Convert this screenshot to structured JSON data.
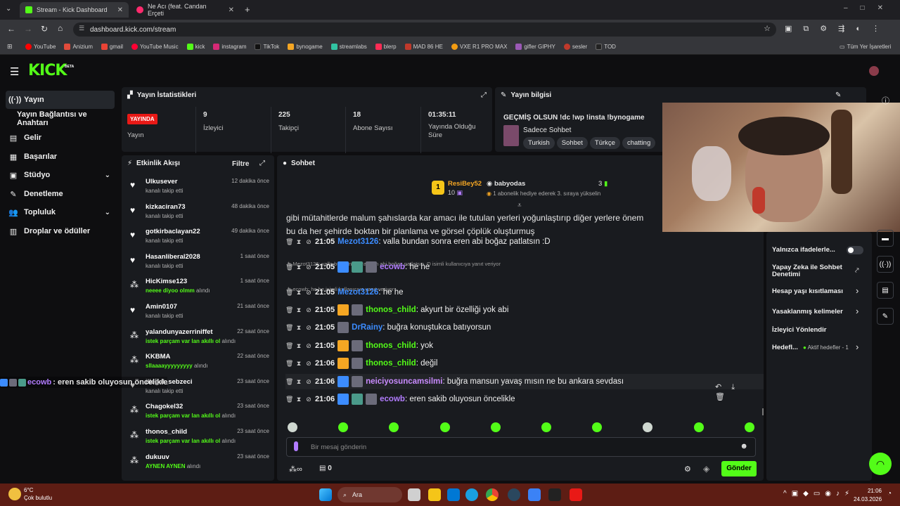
{
  "browser": {
    "tabs": [
      {
        "title": "Stream - Kick Dashboard",
        "active": true
      },
      {
        "title": "Ne Acı (feat. Candan Erçeti",
        "active": false
      }
    ],
    "url": "dashboard.kick.com/stream",
    "bookmarks": [
      "YouTube",
      "Anizium",
      "gmail",
      "YouTube Music",
      "kick",
      "instagram",
      "TikTok",
      "bynogame",
      "streamlabs",
      "blerp",
      "MAD 86 HE",
      "VXE R1 PRO MAX",
      "gifler GIPHY",
      "sesler",
      "TOD"
    ],
    "all_bookmarks": "Tüm Yer İşaretleri"
  },
  "kick": {
    "logo": "KICK",
    "logo_tag": "BETA"
  },
  "sidebar": {
    "items": [
      {
        "label": "Yayın",
        "icon": "broadcast-icon",
        "active": true
      },
      {
        "label": "Yayın Bağlantısı ve Anahtarı",
        "icon": "",
        "active": false
      },
      {
        "label": "Gelir",
        "icon": "dollar-icon",
        "active": false
      },
      {
        "label": "Başarılar",
        "icon": "trophy-icon",
        "active": false
      },
      {
        "label": "Stüdyo",
        "icon": "studio-icon",
        "active": false,
        "expandable": true
      },
      {
        "label": "Denetleme",
        "icon": "wrench-icon",
        "active": false
      },
      {
        "label": "Topluluk",
        "icon": "users-icon",
        "active": false,
        "expandable": true
      },
      {
        "label": "Droplar ve ödüller",
        "icon": "gift-icon",
        "active": false
      }
    ]
  },
  "stats": {
    "title": "Yayın İstatistikleri",
    "live_badge": "YAYINDA",
    "live_label": "Yayın",
    "items": [
      {
        "value": "9",
        "label": "İzleyici"
      },
      {
        "value": "225",
        "label": "Takipçi"
      },
      {
        "value": "18",
        "label": "Abone Sayısı"
      },
      {
        "value": "01:35:11",
        "label": "Yayında Olduğu Süre"
      }
    ]
  },
  "stream_info": {
    "title": "Yayın bilgisi",
    "stream_title": "GEÇMİŞ OLSUN !dc !wp !insta !bynogame",
    "category": "Sadece Sohbet",
    "tags": [
      "Turkish",
      "Sohbet",
      "Türkçe",
      "chatting"
    ]
  },
  "activity": {
    "title": "Etkinlik Akışı",
    "filter": "Filtre",
    "items": [
      {
        "name": "Ulkusever",
        "sub": "kanalı takip etti",
        "highlight": "",
        "time": "12 dakika önce",
        "icon": "heart-icon"
      },
      {
        "name": "kizkaciran73",
        "sub": "kanalı takip etti",
        "highlight": "",
        "time": "48 dakika önce",
        "icon": "heart-icon"
      },
      {
        "name": "gotkirbaclayan22",
        "sub": "kanalı takip etti",
        "highlight": "",
        "time": "49 dakika önce",
        "icon": "heart-icon"
      },
      {
        "name": "Hasanliberal2028",
        "sub": "kanalı takip etti",
        "highlight": "",
        "time": "1 saat önce",
        "icon": "heart-icon"
      },
      {
        "name": "HicKimse123",
        "sub": "alındı",
        "highlight": "neeee diyoo olmm",
        "time": "1 saat önce",
        "icon": "kicks-icon"
      },
      {
        "name": "Amin0107",
        "sub": "kanalı takip etti",
        "highlight": "",
        "time": "21 saat önce",
        "icon": "heart-icon"
      },
      {
        "name": "yalandunyazerriniffet",
        "sub": "alındı",
        "highlight": "istek parçam var lan akıllı ol",
        "time": "22 saat önce",
        "icon": "kicks-icon"
      },
      {
        "name": "KKBMA",
        "sub": "alındı",
        "highlight": "sllaaaayyyyyyyyy",
        "time": "22 saat önce",
        "icon": "kicks-icon"
      },
      {
        "name": "illegal_sebzeci",
        "sub": "kanalı takip etti",
        "highlight": "",
        "time": "23 saat önce",
        "icon": "heart-icon"
      },
      {
        "name": "Chagokel32",
        "sub": "alındı",
        "highlight": "istek parçam var lan akıllı ol",
        "time": "23 saat önce",
        "icon": "kicks-icon"
      },
      {
        "name": "thonos_child",
        "sub": "alındı",
        "highlight": "istek parçam var lan akıllı ol",
        "time": "23 saat önce",
        "icon": "kicks-icon"
      },
      {
        "name": "dukuuv",
        "sub": "alındı",
        "highlight": "AYNEN AYNEN",
        "time": "23 saat önce",
        "icon": "kicks-icon"
      }
    ]
  },
  "chat": {
    "title": "Sohbet",
    "pinned": {
      "rank": "1",
      "user": "ResiBey52",
      "count": "10",
      "gifter": "babyodas",
      "gift_count": "3",
      "note": "1 abonelik hediye ederek 3. sıraya yükselin"
    },
    "prev_line1": "gibi mütahitlerde malum şahıslarda kar amacı ile tutulan yerleri yoğunlaştırıp diğer yerlere önem",
    "prev_line2": "bu da her şehirde boktan bir planlama ve görsel çöplük oluşturmuş",
    "messages": [
      {
        "time": "21:05",
        "user": "Mezot3126",
        "color": "#3c8cff",
        "text": ": valla bundan sonra eren abi boğaz patlatsın :D",
        "reply": ""
      },
      {
        "time": "21:05",
        "user": "ecowb",
        "color": "#b27cff",
        "text": ": he he",
        "reply": "Mezot3126: valla bundan sonra eren abi boğaz patlatsın :D isimli kullanıcıya yanıt veriyor"
      },
      {
        "time": "21:05",
        "user": "Mezot3126",
        "color": "#3c8cff",
        "text": ": he he",
        "reply": "ecowb: he he isimli kullanıcıya yanıt veriyor"
      },
      {
        "time": "21:05",
        "user": "thonos_child",
        "color": "#53fc18",
        "text": ": akyurt bir özelliği yok abi",
        "reply": ""
      },
      {
        "time": "21:05",
        "user": "DrRainy",
        "color": "#3c8cff",
        "text": ": buğra konuştukca batıyorsun",
        "reply": ""
      },
      {
        "time": "21:05",
        "user": "thonos_child",
        "color": "#53fc18",
        "text": ": yok",
        "reply": ""
      },
      {
        "time": "21:06",
        "user": "thonos_child",
        "color": "#53fc18",
        "text": ": değil",
        "reply": ""
      },
      {
        "time": "21:06",
        "user": "neiciyosuncamsilmi",
        "color": "#c98bff",
        "text": ": buğra mansun yavaş mısın ne bu ankara sevdası",
        "reply": ""
      },
      {
        "time": "21:06",
        "user": "ecowb",
        "color": "#b27cff",
        "text": ": eren sakib oluyosun öncelikle",
        "reply": ""
      }
    ],
    "overlay_user": "ecowb",
    "overlay_text": ": eren sakib oluyosun öncelikle",
    "input_placeholder": "Bir mesaj gönderin",
    "points": "0",
    "send": "Gönder"
  },
  "settings": {
    "items": [
      {
        "label": "Yalnızca ifadelerle...",
        "control": "toggle-off"
      },
      {
        "label": "Yapay Zeka ile Sohbet Denetimi",
        "control": "external"
      },
      {
        "label": "Hesap yaşı kısıtlaması",
        "control": "chevron"
      },
      {
        "label": "Yasaklanmış kelimeler",
        "control": "chevron"
      },
      {
        "label": "İzleyici Yönlendir",
        "control": ""
      },
      {
        "label": "Hedefl...",
        "control": "chevron",
        "status": "Aktif hedefler - 1"
      }
    ]
  },
  "taskbar": {
    "weather_temp": "6°C",
    "weather_desc": "Çok bulutlu",
    "search": "Ara",
    "time": "21:06",
    "date": "24.03.2026"
  },
  "colors": {
    "brand": "#53fc18",
    "live": "#e91916",
    "panel": "#191b1f",
    "bg": "#0e0e10"
  }
}
